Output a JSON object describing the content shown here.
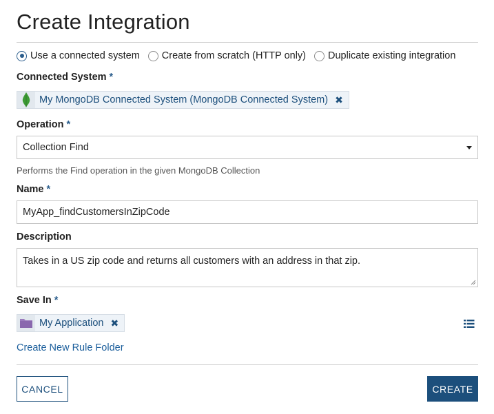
{
  "title": "Create Integration",
  "source_options": [
    {
      "label": "Use a connected system",
      "selected": true
    },
    {
      "label": "Create from scratch (HTTP only)",
      "selected": false
    },
    {
      "label": "Duplicate existing integration",
      "selected": false
    }
  ],
  "connected_system": {
    "label": "Connected System",
    "required_mark": "*",
    "value": "My MongoDB Connected System (MongoDB Connected System)",
    "icon": "mongodb-leaf-icon"
  },
  "operation": {
    "label": "Operation",
    "required_mark": "*",
    "value": "Collection Find",
    "help": "Performs the Find operation in the given MongoDB Collection"
  },
  "name": {
    "label": "Name",
    "required_mark": "*",
    "value": "MyApp_findCustomersInZipCode"
  },
  "description": {
    "label": "Description",
    "value": "Takes in a US zip code and returns all customers with an address in that zip."
  },
  "save_in": {
    "label": "Save In",
    "required_mark": "*",
    "value": "My Application",
    "icon": "folder-icon",
    "picker_icon": "list-icon"
  },
  "create_folder_link": "Create New Rule Folder",
  "buttons": {
    "cancel": "CANCEL",
    "create": "CREATE"
  },
  "colors": {
    "accent": "#1c4f7c",
    "chip_bg": "#eef3f8",
    "folder": "#9b7bbd",
    "mongodb_green": "#3d9b35"
  }
}
